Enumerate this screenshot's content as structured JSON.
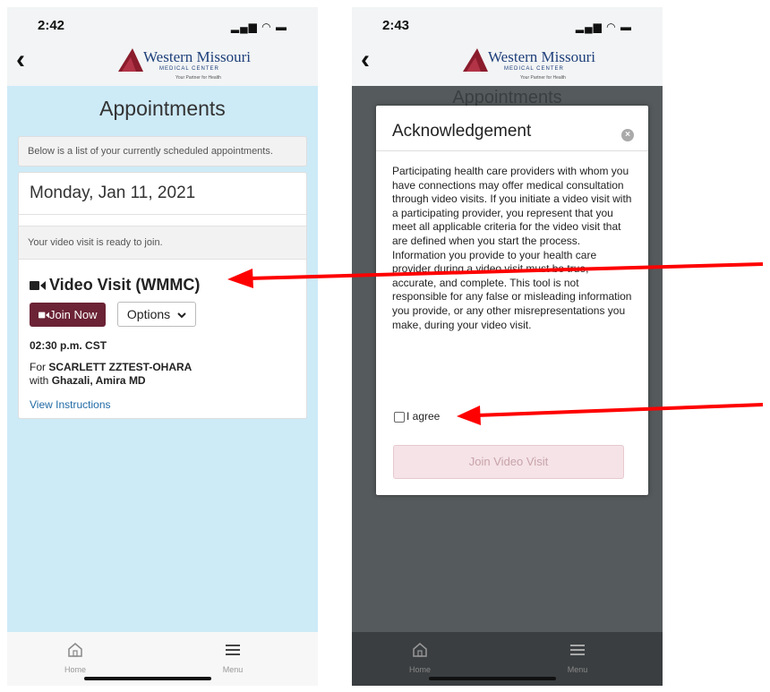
{
  "left_screen": {
    "status_time": "2:42",
    "logo": {
      "name": "Western Missouri",
      "sub": "MEDICAL CENTER",
      "tagline": "Your Partner for Health"
    },
    "page_title": "Appointments",
    "info_text": "Below is a list of your currently scheduled appointments.",
    "appointment": {
      "date": "Monday, Jan 11, 2021",
      "ready_text": "Your video visit is ready to join.",
      "title": "Video Visit (WMMC)",
      "join_label": "Join Now",
      "options_label": "Options",
      "time": "02:30 p.m. CST",
      "for_prefix": "For ",
      "patient": "SCARLETT ZZTEST-OHARA",
      "with_prefix": "with ",
      "provider": "Ghazali, Amira MD",
      "instructions_link": "View Instructions"
    },
    "nav": {
      "home": "Home",
      "menu": "Menu"
    }
  },
  "right_screen": {
    "status_time": "2:43",
    "bg_title": "Appointments",
    "modal": {
      "title": "Acknowledgement",
      "body": "Participating health care providers with whom you have connections may offer medical consultation through video visits. If you initiate a video visit with a participating provider, you represent that you meet all applicable criteria for the video visit that are defined when you start the process. Information you provide to your health care provider during a video visit must be true, accurate, and complete. This tool is not responsible for any false or misleading information you provide, or any other misrepresentations you make, during your video visit.",
      "agree_label": "I agree",
      "join_button": "Join Video Visit"
    },
    "nav": {
      "home": "Home",
      "menu": "Menu"
    }
  },
  "colors": {
    "content_bg": "#cdeaf7",
    "join_button": "#6b2335",
    "link": "#1f6aa5",
    "arrow": "#ff0000",
    "overlay": "#555a5c"
  }
}
